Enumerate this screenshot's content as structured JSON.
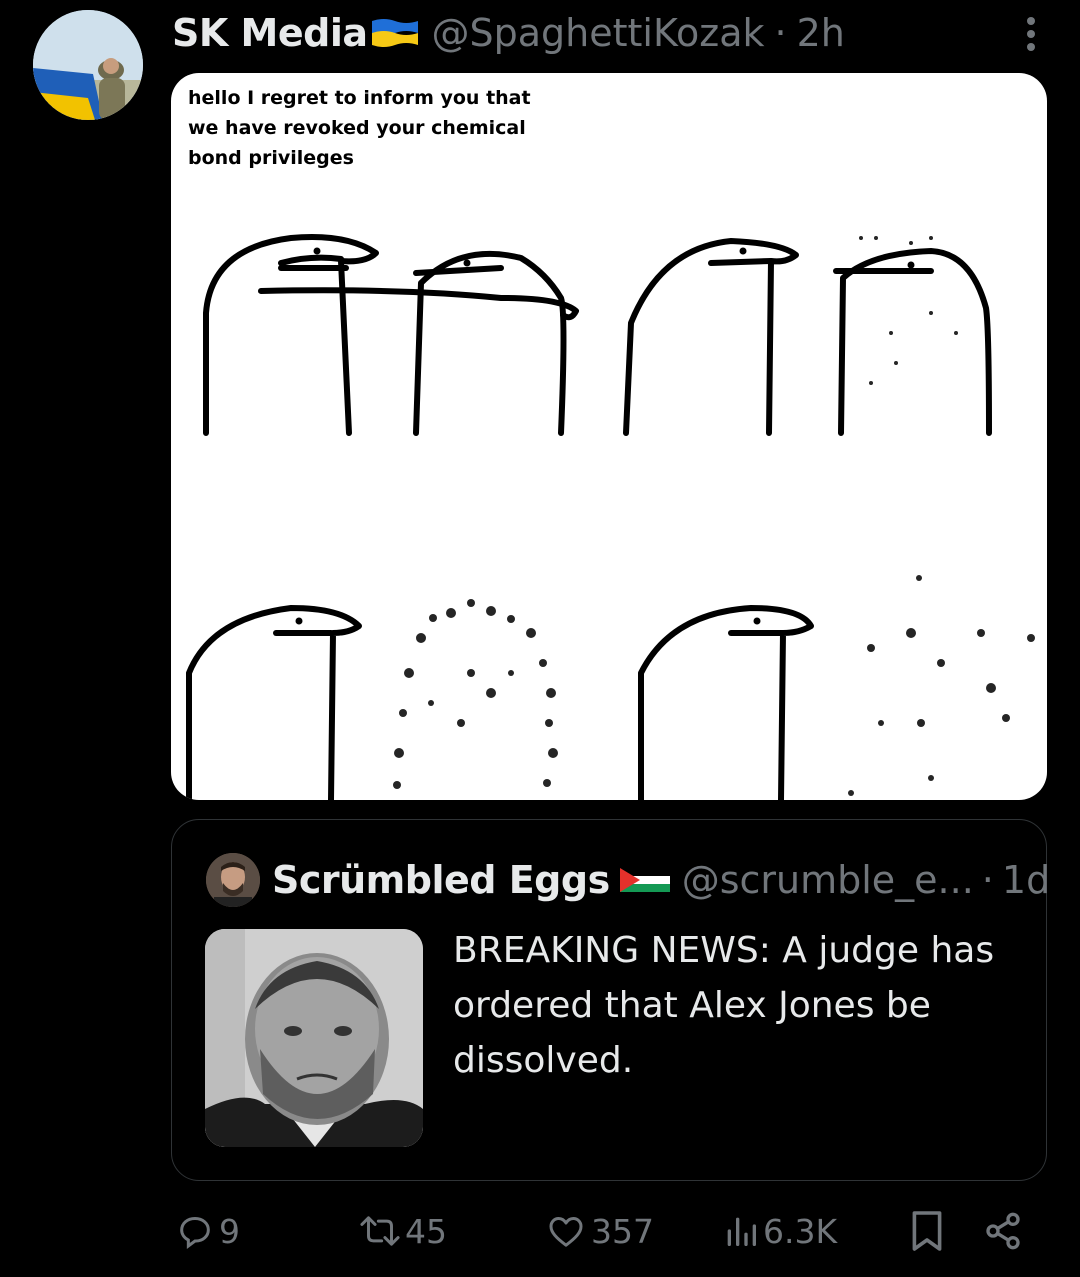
{
  "post": {
    "display_name": "SK Media",
    "handle": "@SpaghettiKozak",
    "separator": "·",
    "time": "2h"
  },
  "meme": {
    "caption": "hello I regret to inform you that\nwe have revoked your chemical\nbond privileges"
  },
  "quote": {
    "display_name": "Scrümbled Eggs",
    "handle": "@scrumble_e...",
    "separator": "·",
    "time": "1d",
    "text": "BREAKING NEWS: A judge has ordered that Alex Jones be dissolved."
  },
  "actions": {
    "replies": "9",
    "reposts": "45",
    "likes": "357",
    "views": "6.3K"
  },
  "colors": {
    "background": "#000000",
    "text_primary": "#e7e9ea",
    "text_secondary": "#71767b",
    "border": "#2f3336"
  },
  "icons": [
    "more-icon",
    "reply-icon",
    "repost-icon",
    "like-icon",
    "views-icon",
    "bookmark-icon",
    "share-icon"
  ]
}
